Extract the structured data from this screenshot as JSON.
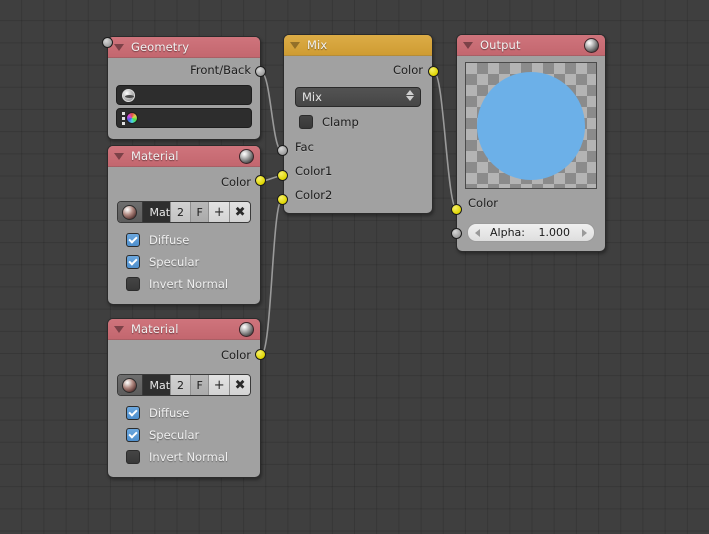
{
  "editor": {
    "name": "Blender Node Editor",
    "background_color": "#3f3f3f",
    "grid_color": "#363636"
  },
  "colors": {
    "header_input_red": "#c3676f",
    "header_color_orange": "#cf9c33",
    "node_body": "#a1a1a1",
    "socket_color_yellow": "#dfd600",
    "socket_value_gray": "#9d9d9d",
    "checkbox_on_blue": "#4e8fcd",
    "preview_circle_blue": "#6cb0e8",
    "link_noodle": "#9a9a9a"
  },
  "nodes": [
    {
      "id": "geometry",
      "title": "Geometry",
      "header_color": "#c3676f",
      "collapse_icon": "triangle-down-icon",
      "outputs": [
        {
          "label": "Front/Back",
          "socket": "socket-gray"
        }
      ],
      "fields": [
        {
          "icon": "uv-map-icon",
          "value": "",
          "placeholder": ""
        },
        {
          "icon": "vertex-color-icon",
          "value": "",
          "placeholder": ""
        }
      ]
    },
    {
      "id": "material-top",
      "title": "Material",
      "header_color": "#c3676f",
      "header_icon": "material-sphere-icon",
      "collapse_icon": "triangle-down-icon",
      "outputs": [
        {
          "label": "Color",
          "socket": "socket-yellow"
        }
      ],
      "datablock": {
        "icon": "material-sphere-icon",
        "name": "Mat",
        "users": "2",
        "fake_user": "F",
        "new_label": "+",
        "unlink_label": "✖"
      },
      "checkboxes": [
        {
          "label": "Diffuse",
          "checked": true
        },
        {
          "label": "Specular",
          "checked": true
        },
        {
          "label": "Invert Normal",
          "checked": false
        }
      ]
    },
    {
      "id": "material-bottom",
      "title": "Material",
      "header_color": "#c3676f",
      "header_icon": "material-sphere-icon",
      "collapse_icon": "triangle-down-icon",
      "outputs": [
        {
          "label": "Color",
          "socket": "socket-yellow"
        }
      ],
      "datablock": {
        "icon": "material-sphere-icon",
        "name": "Mat",
        "users": "2",
        "fake_user": "F",
        "new_label": "+",
        "unlink_label": "✖"
      },
      "checkboxes": [
        {
          "label": "Diffuse",
          "checked": true
        },
        {
          "label": "Specular",
          "checked": true
        },
        {
          "label": "Invert Normal",
          "checked": false
        }
      ]
    },
    {
      "id": "mix",
      "title": "Mix",
      "header_color": "#cf9c33",
      "collapse_icon": "triangle-down-icon",
      "outputs": [
        {
          "label": "Color",
          "socket": "socket-yellow"
        }
      ],
      "blend_mode": {
        "value": "Mix",
        "widget": "dropdown-enum"
      },
      "checkboxes": [
        {
          "label": "Clamp",
          "checked": false
        }
      ],
      "inputs": [
        {
          "label": "Fac",
          "socket": "socket-gray"
        },
        {
          "label": "Color1",
          "socket": "socket-yellow"
        },
        {
          "label": "Color2",
          "socket": "socket-yellow"
        }
      ]
    },
    {
      "id": "output",
      "title": "Output",
      "header_color": "#c3676f",
      "header_icon": "material-sphere-icon",
      "collapse_icon": "triangle-down-icon",
      "preview": {
        "shape": "circle",
        "fill": "#6cb0e8",
        "background": "checkerboard-alpha"
      },
      "inputs": [
        {
          "label": "Color",
          "socket": "socket-yellow"
        }
      ],
      "alpha": {
        "label": "Alpha:",
        "value": "1.000",
        "dec_icon": "arrow-left-icon",
        "inc_icon": "arrow-right-icon"
      }
    }
  ],
  "links": [
    {
      "from": "geometry.Front/Back",
      "to": "mix.Fac"
    },
    {
      "from": "material-top.Color",
      "to": "mix.Color1"
    },
    {
      "from": "material-bottom.Color",
      "to": "mix.Color2"
    },
    {
      "from": "mix.Color",
      "to": "output.Color"
    }
  ]
}
